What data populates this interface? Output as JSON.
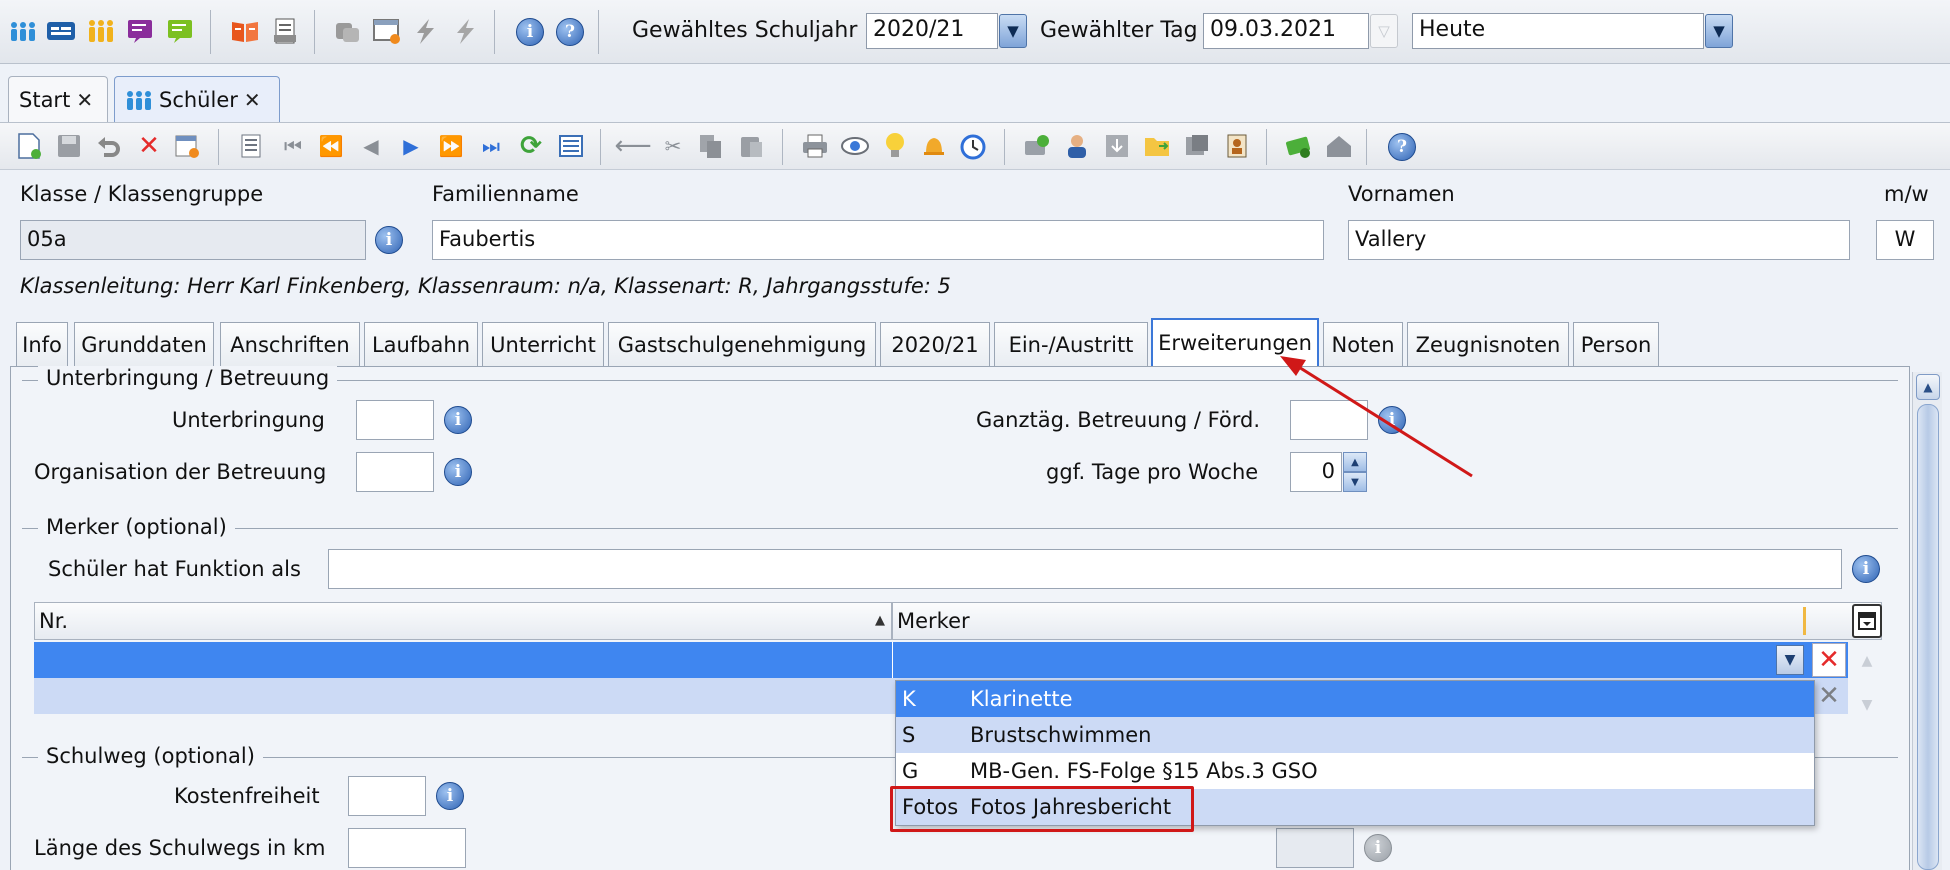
{
  "colors": {
    "accent": "#3c78d8",
    "selected_row": "#3f86f0",
    "alt_row": "#ccdaf5",
    "annotation_red": "#d01818",
    "delete_red": "#e52b2b"
  },
  "toolbar": {
    "icons": [
      "people-icon",
      "class-icon",
      "teachers-icon",
      "screen-purple-icon",
      "screen-green-icon",
      "book-icon",
      "report-icon",
      "gear-grey-icon",
      "window-warning-icon",
      "lightning-icon",
      "lightning-alt-icon",
      "info-icon",
      "help-icon"
    ],
    "school_year_label": "Gewähltes Schuljahr",
    "school_year_value": "2020/21",
    "day_label": "Gewählter Tag",
    "day_value": "09.03.2021",
    "today_value": "Heute"
  },
  "doc_tabs": [
    {
      "label": "Start",
      "active": false
    },
    {
      "label": "Schüler",
      "active": true
    }
  ],
  "action_icons": [
    "new-icon",
    "save-icon",
    "undo-icon",
    "delete-icon",
    "edit-form-icon",
    "list-icon",
    "first-icon",
    "prev-fast-icon",
    "prev-icon",
    "next-icon",
    "next-fast-icon",
    "last-icon",
    "refresh-icon",
    "list-view-icon",
    "back-arrow-icon",
    "cut-icon",
    "copy-icon",
    "paste-icon",
    "print-icon",
    "preview-icon",
    "idea-icon",
    "bell-icon",
    "alarm-icon",
    "export-icon",
    "user-icon",
    "import-icon",
    "folder-icon",
    "module-icon",
    "contacts-icon",
    "money-icon",
    "house-icon",
    "help-icon"
  ],
  "header": {
    "class_label": "Klasse / Klassengruppe",
    "class_value": "05a",
    "family_label": "Familienname",
    "family_value": "Faubertis",
    "first_label": "Vornamen",
    "first_value": "Vallery",
    "gender_label": "m/w",
    "gender_value": "W",
    "info_line": "Klassenleitung: Herr Karl Finkenberg, Klassenraum: n/a, Klassenart: R, Jahrgangsstufe: 5"
  },
  "register_tabs": [
    "Info",
    "Grunddaten",
    "Anschriften",
    "Laufbahn",
    "Unterricht",
    "Gastschulgenehmigung",
    "2020/21",
    "Ein-/Austritt",
    "Erweiterungen",
    "Noten",
    "Zeugnisnoten",
    "Person"
  ],
  "active_register_tab": "Erweiterungen",
  "section_care": {
    "title": "Unterbringung / Betreuung",
    "accommodation_label": "Unterbringung",
    "organisation_label": "Organisation der Betreuung",
    "allday_label": "Ganztäg. Betreuung / Förd.",
    "days_label": "ggf. Tage pro Woche",
    "days_value": "0"
  },
  "section_marker": {
    "title": "Merker (optional)",
    "function_label": "Schüler hat Funktion als",
    "col_nr": "Nr.",
    "col_marker": "Merker"
  },
  "dropdown_items": [
    {
      "key": "K",
      "value": "Klarinette",
      "state": "selected"
    },
    {
      "key": "S",
      "value": "Brustschwimmen",
      "state": "alt"
    },
    {
      "key": "G",
      "value": "MB-Gen. FS-Folge §15 Abs.3 GSO",
      "state": "normal"
    },
    {
      "key": "Fotos",
      "value": "Fotos Jahresbericht",
      "state": "highlighted"
    }
  ],
  "section_route": {
    "title": "Schulweg (optional)",
    "free_label": "Kostenfreiheit",
    "length_label": "Länge des Schulwegs in km"
  }
}
